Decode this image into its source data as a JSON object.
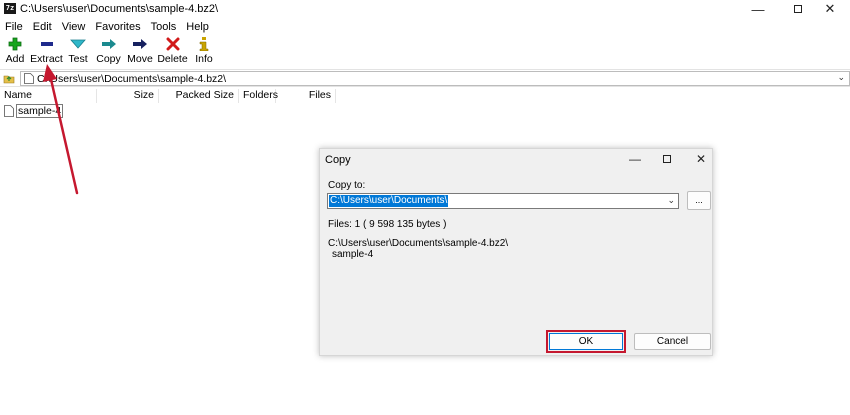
{
  "window": {
    "app_icon_text": "7z",
    "title": "C:\\Users\\user\\Documents\\sample-4.bz2\\",
    "minimize": "—",
    "close": "✕"
  },
  "menu": {
    "items": [
      "File",
      "Edit",
      "View",
      "Favorites",
      "Tools",
      "Help"
    ]
  },
  "toolbar": {
    "add": "Add",
    "extract": "Extract",
    "test": "Test",
    "copy": "Copy",
    "move": "Move",
    "delete": "Delete",
    "info": "Info"
  },
  "address": {
    "path": "C:\\Users\\user\\Documents\\sample-4.bz2\\",
    "chevron": "⌄"
  },
  "file_list": {
    "columns": [
      "Name",
      "Size",
      "Packed Size",
      "Folders",
      "Files"
    ],
    "rows": [
      {
        "name": "sample-4"
      }
    ]
  },
  "dialog": {
    "title": "Copy",
    "minimize": "—",
    "close": "✕",
    "copy_to_label": "Copy to:",
    "copy_to_value": "C:\\Users\\user\\Documents\\",
    "combo_chevron": "⌄",
    "browse_label": "...",
    "files_info": "Files: 1    ( 9 598 135 bytes )",
    "source_path": "C:\\Users\\user\\Documents\\sample-4.bz2\\",
    "source_item": "sample-4",
    "ok_label": "OK",
    "cancel_label": "Cancel"
  },
  "colors": {
    "annotation_red": "#c5182f",
    "selection_blue": "#0078d7"
  }
}
